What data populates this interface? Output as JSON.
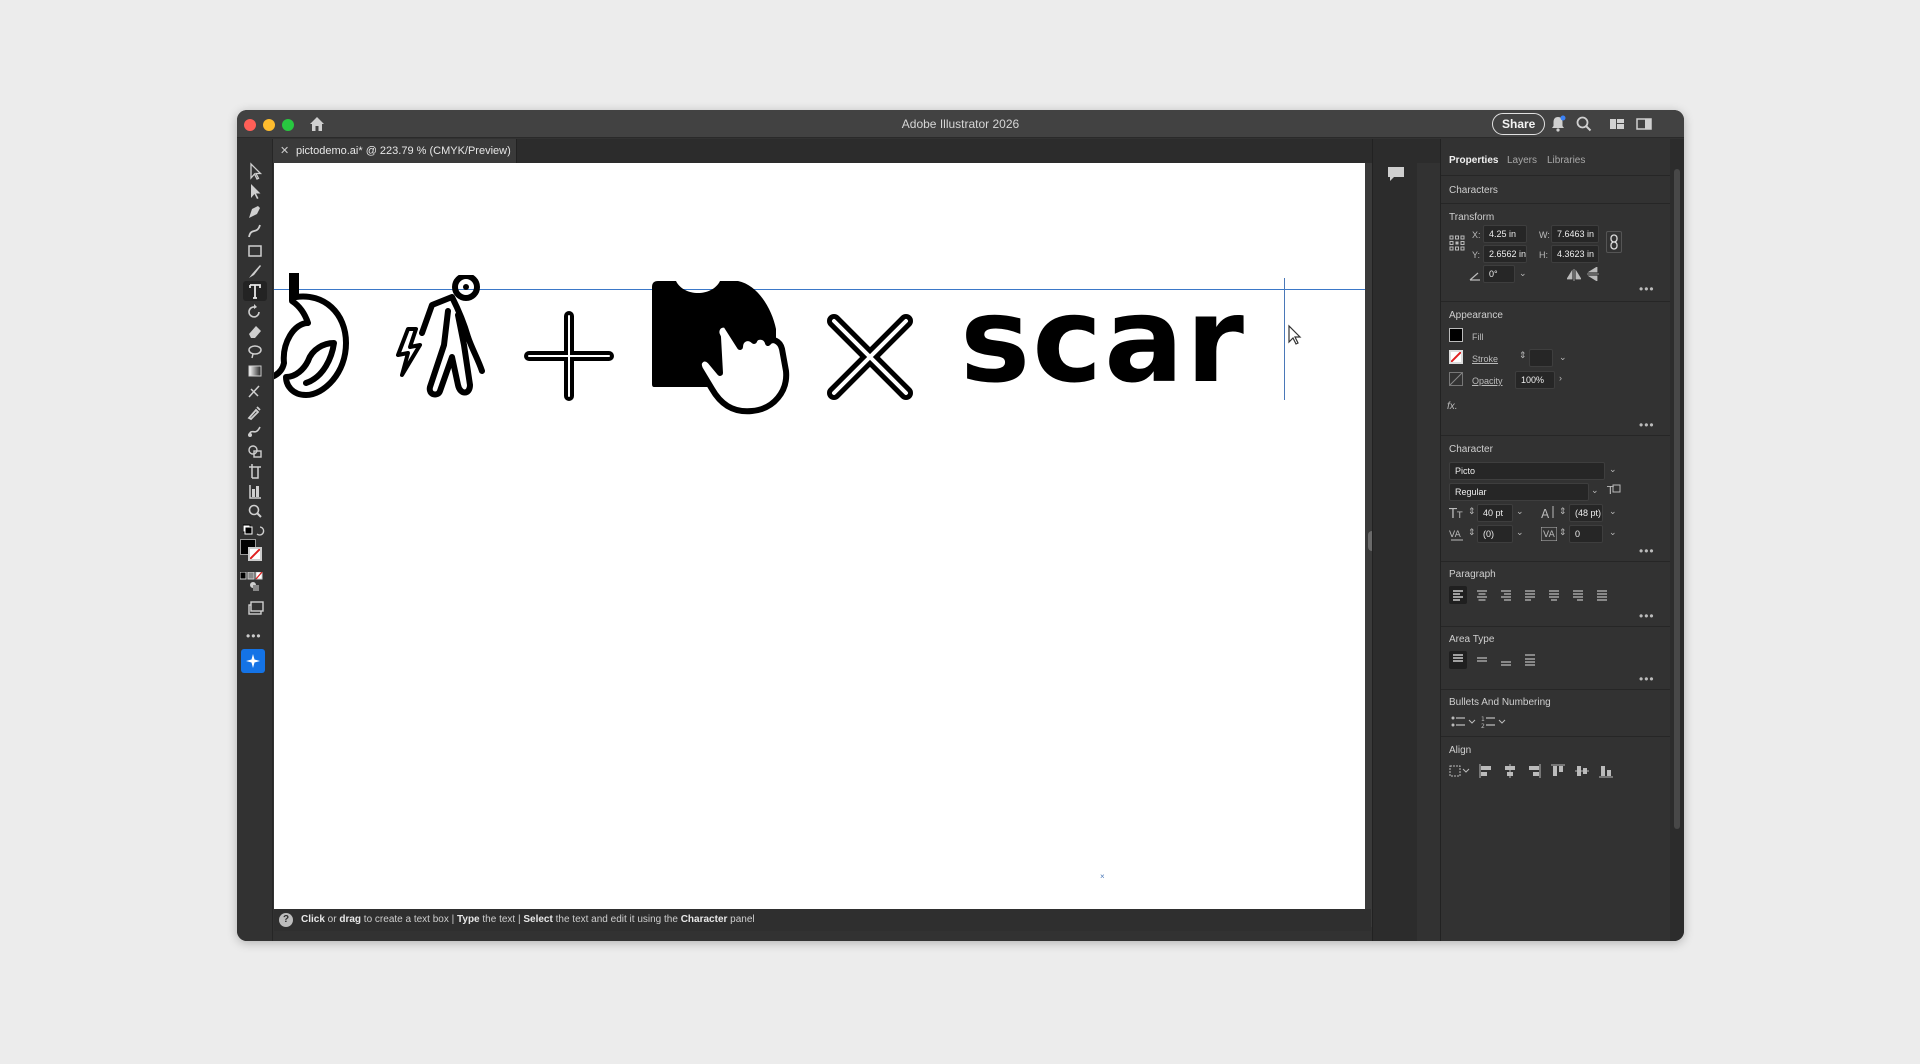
{
  "window": {
    "title": "Adobe Illustrator 2026",
    "share_label": "Share",
    "traffic_lights": [
      "#ff5f57",
      "#febc2e",
      "#28c840"
    ]
  },
  "document_tab": {
    "label": "pictodemo.ai* @ 223.79 % (CMYK/Preview)",
    "close_glyph": "✕"
  },
  "toolbar": {
    "tools": [
      "selection-tool",
      "direct-selection-tool",
      "pen-tool",
      "curvature-tool",
      "rectangle-tool",
      "paintbrush-tool",
      "type-tool",
      "rotate-tool",
      "eraser-tool",
      "lasso-tool",
      "gradient-tool",
      "eyedropper-tool",
      "blend-tool",
      "width-tool",
      "shape-builder-tool",
      "artboard-tool",
      "bar-graph-tool",
      "zoom-tool"
    ],
    "active_tool": "type-tool",
    "fill_color": "#000000",
    "stroke_color": "none"
  },
  "canvas": {
    "text": "scar",
    "glyphs": [
      "stomach-icon",
      "pain-person-icon",
      "plus-icon",
      "tshirt-touch-icon",
      "times-icon"
    ]
  },
  "status_bar": {
    "help_glyph": "?",
    "parts": [
      {
        "bold": "Click",
        "text": " or "
      },
      {
        "bold": "drag",
        "text": " to create a text box  |  "
      },
      {
        "bold": "Type",
        "text": " the text  |  "
      },
      {
        "bold": "Select",
        "text": " the text and edit it using the "
      },
      {
        "bold": "Character",
        "text": " panel"
      }
    ]
  },
  "panel": {
    "tabs": [
      "Properties",
      "Layers",
      "Libraries"
    ],
    "active_tab": "Properties",
    "selection_type": "Characters",
    "transform": {
      "title": "Transform",
      "x_label": "X:",
      "x": "4.25 in",
      "y_label": "Y:",
      "y": "2.6562 in",
      "w_label": "W:",
      "w": "7.6463 in",
      "h_label": "H:",
      "h": "4.3623 in",
      "angle": "0°"
    },
    "appearance": {
      "title": "Appearance",
      "fill_label": "Fill",
      "stroke_label": "Stroke",
      "opacity_label": "Opacity",
      "opacity": "100%",
      "fx_label": "fx."
    },
    "character": {
      "title": "Character",
      "font": "Picto",
      "style": "Regular",
      "size": "40 pt",
      "leading": "(48 pt)",
      "kerning": "(0)",
      "tracking": "0"
    },
    "paragraph": {
      "title": "Paragraph"
    },
    "area_type": {
      "title": "Area Type"
    },
    "bullets": {
      "title": "Bullets And Numbering"
    },
    "align": {
      "title": "Align"
    }
  }
}
